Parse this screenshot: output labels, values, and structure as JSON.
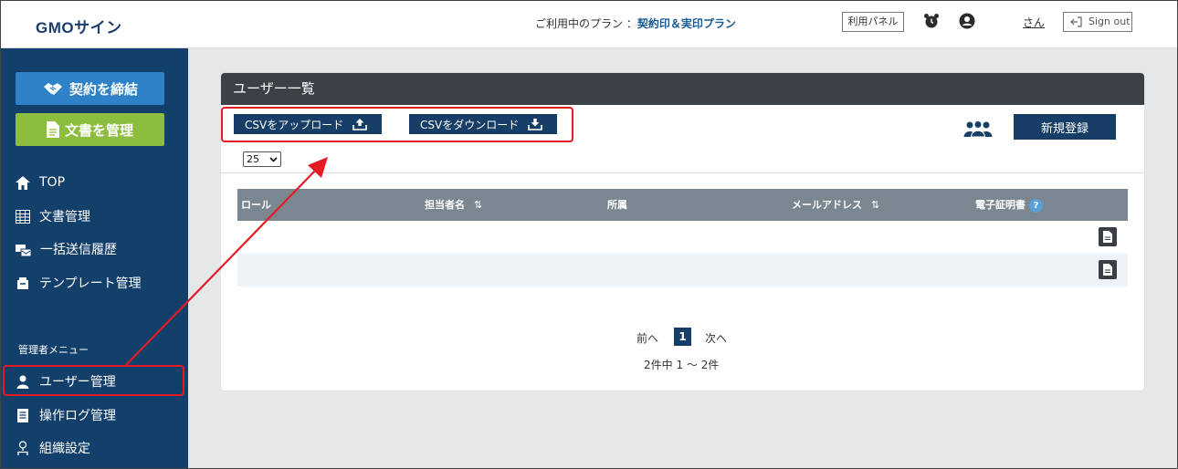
{
  "header": {
    "logo": "GMOサイン",
    "plan_label": "ご利用中のプラン ：",
    "plan_name": "契約印＆実印プラン",
    "panel_button": "利用パネル",
    "user_name": "さん",
    "sign_out": "Sign out"
  },
  "sidebar": {
    "contract_button": "契約を締結",
    "docs_button": "文書を管理",
    "items": [
      {
        "label": "TOP"
      },
      {
        "label": "文書管理"
      },
      {
        "label": "一括送信履歴"
      },
      {
        "label": "テンプレート管理"
      }
    ],
    "admin_label": "管理者メニュー",
    "admin_items": [
      {
        "label": "ユーザー管理"
      },
      {
        "label": "操作ログ管理"
      },
      {
        "label": "組織設定"
      }
    ]
  },
  "main": {
    "title": "ユーザー一覧",
    "csv_upload": "CSVをアップロード",
    "csv_download": "CSVをダウンロード",
    "register_button": "新規登録",
    "page_size": "25",
    "table": {
      "columns": [
        "ロール",
        "担当者名",
        "所属",
        "メールアドレス",
        "電子証明書"
      ],
      "sort_symbol": "⇅",
      "help_symbol": "?",
      "row_count": 2
    },
    "pagination": {
      "prev": "前へ",
      "current": "1",
      "next": "次へ",
      "total": "2件中 1 ～ 2件"
    }
  },
  "colors": {
    "sidebar": "#133f6b",
    "primary_button": "#173e66",
    "contract_button": "#2f82c7",
    "docs_button": "#8cbd3f",
    "highlight": "#e41b23"
  }
}
